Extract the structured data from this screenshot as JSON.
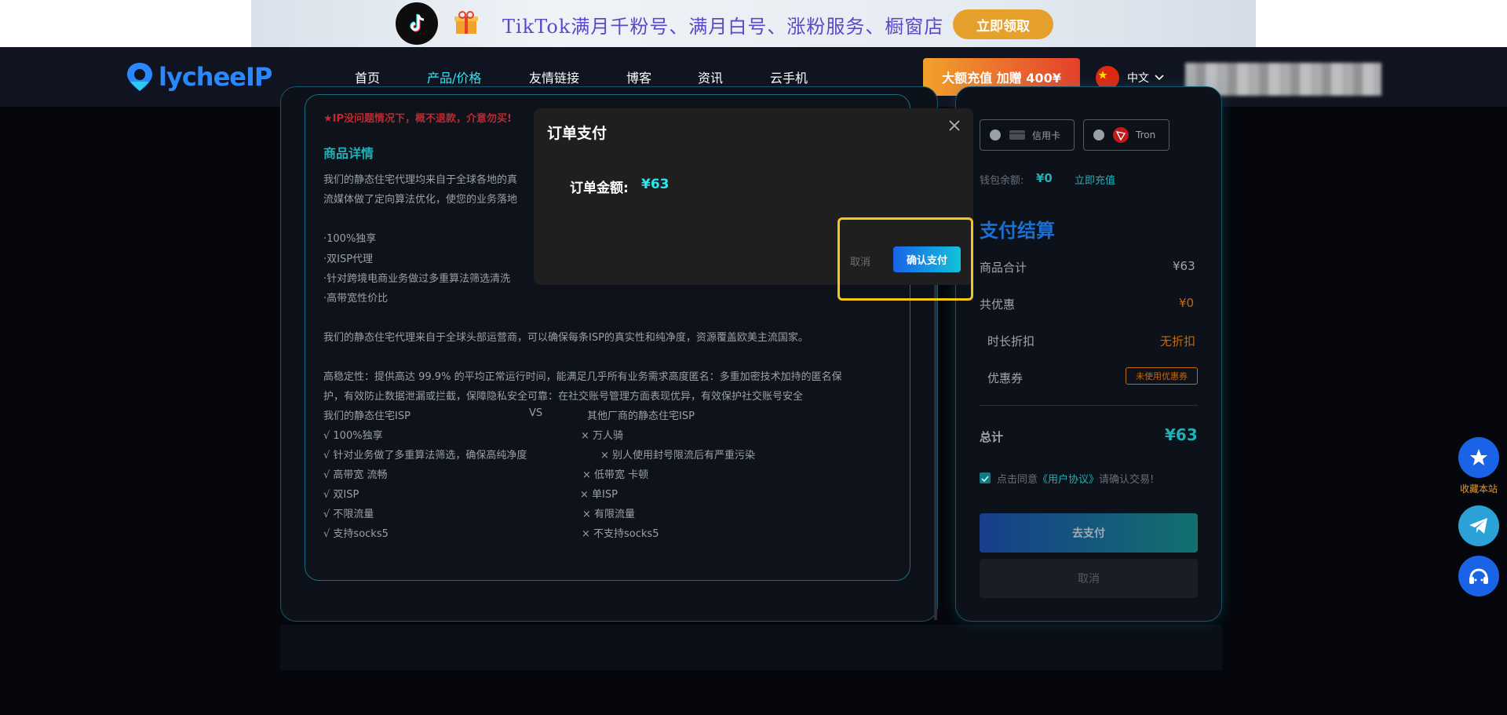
{
  "banner": {
    "text": "TikTok满月千粉号、满月白号、涨粉服务、橱窗店",
    "cta": "立即领取"
  },
  "nav": {
    "logo_text": "lycheeIP",
    "items": [
      "首页",
      "产品/价格",
      "友情链接",
      "博客",
      "资讯",
      "云手机"
    ],
    "active_index": 1,
    "promo": "大额充值 加赠 400¥",
    "language": "中文"
  },
  "product": {
    "warning": "★IP没问题情况下，概不退款，介意勿买!",
    "section_title": "商品详情",
    "intro_1": "我们的静态住宅代理均来自于全球各地的真",
    "intro_2": "流媒体做了定向算法优化，使您的业务落地",
    "features": [
      "·100%独享",
      "·双ISP代理",
      "·针对跨境电商业务做过多重算法筛选清洗",
      "·高带宽性价比"
    ],
    "para_1": "我们的静态住宅代理来自于全球头部运营商，可以确保每条ISP的真实性和纯净度，资源覆盖欧美主流国家。",
    "para_2a": "高稳定性：提供高达 99.9% 的平均正常运行时间，能满足几乎所有业务需求高度匿名：多重加密技术加持的匿名保",
    "para_2b": "护，有效防止数据泄漏或拦截，保障隐私安全可靠：在社交账号管理方面表现优异，有效保护社交账号安全",
    "compare": {
      "left_header": "我们的静态住宅ISP",
      "vs": "VS",
      "right_header": "其他厂商的静态住宅ISP",
      "left": [
        "√  100%独享",
        "√  针对业务做了多重算法筛选，确保高纯净度",
        "√  高带宽 流畅",
        "√  双ISP",
        "√  不限流量",
        "√  支持socks5"
      ],
      "right": [
        "× 万人骑",
        "× 别人使用封号限流后有严重污染",
        "× 低带宽 卡顿",
        "× 单ISP",
        "× 有限流量",
        "× 不支持socks5"
      ]
    }
  },
  "payment": {
    "methods": [
      "信用卡",
      "Tron"
    ],
    "wallet_label": "钱包余额:",
    "wallet_value": "¥0",
    "recharge": "立即充值",
    "title": "支付结算",
    "rows": {
      "subtotal_label": "商品合计",
      "subtotal_value": "¥63",
      "discount_label": "共优惠",
      "discount_value": "¥0",
      "duration_label": "时长折扣",
      "duration_value": "无折扣",
      "coupon_label": "优惠券",
      "coupon_value": "未使用优惠券",
      "total_label": "总计",
      "total_value": "¥63"
    },
    "agree_prefix": "点击同意",
    "agree_link": "《用户协议》",
    "agree_suffix": "请确认交易!",
    "go_pay": "去支付",
    "cancel": "取消"
  },
  "modal": {
    "title": "订单支付",
    "close": "×",
    "amount_label": "订单金额:",
    "amount_value": "¥63",
    "cancel": "取消",
    "confirm": "确认支付"
  },
  "side": {
    "bookmark_label": "收藏本站"
  },
  "colors": {
    "accent_cyan": "#2ee6f2",
    "brand_blue": "#1a63e6",
    "highlight": "#f5c518"
  }
}
